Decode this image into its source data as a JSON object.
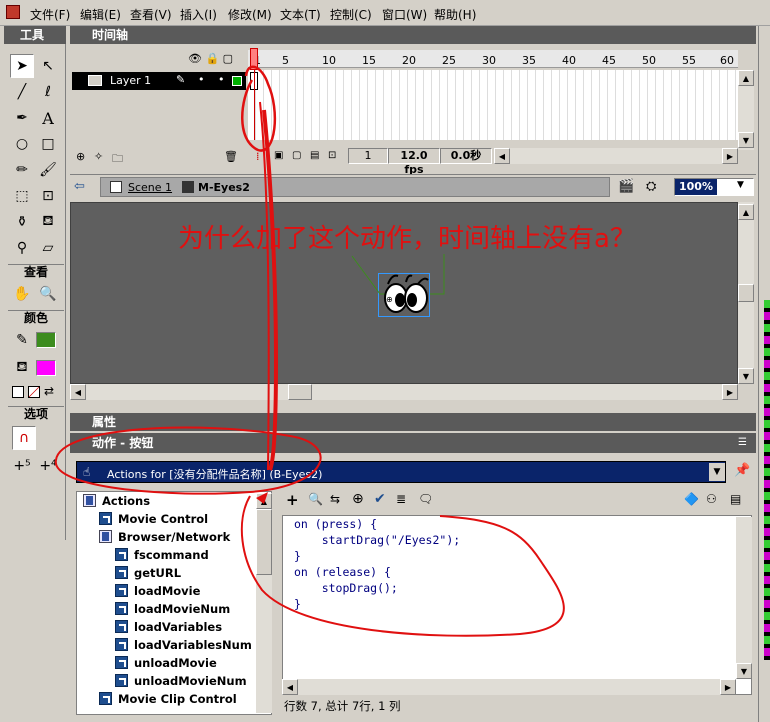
{
  "menu": {
    "items": [
      "文件(F)",
      "编辑(E)",
      "查看(V)",
      "插入(I)",
      "修改(M)",
      "文本(T)",
      "控制(C)",
      "窗口(W)",
      "帮助(H)"
    ]
  },
  "tools_panel": {
    "title": "工具",
    "view_label": "查看",
    "colors_label": "颜色",
    "options_label": "选项"
  },
  "timeline": {
    "title": "时间轴",
    "layer_name": "Layer 1",
    "frame_numbers": [
      "1",
      "5",
      "10",
      "15",
      "20",
      "25",
      "30",
      "35",
      "40",
      "45",
      "50",
      "55",
      "60"
    ],
    "current_frame": "1",
    "fps": "12.0 fps",
    "time": "0.0秒"
  },
  "breadcrumb": {
    "scene": "Scene 1",
    "symbol": "M-Eyes2",
    "zoom": "100%"
  },
  "annotation": {
    "question": "为什么加了这个动作，时间轴上没有a？"
  },
  "properties_panel": {
    "title": "属性"
  },
  "actions_panel": {
    "title": "动作 - 按钮",
    "target": "Actions for [没有分配件品名称] (B-Eyes2)",
    "tree": [
      {
        "label": "Actions",
        "icon": "book-icon",
        "bold": true
      },
      {
        "label": "Movie Control",
        "icon": "category-icon",
        "bold": true
      },
      {
        "label": "Browser/Network",
        "icon": "book-icon",
        "bold": true
      },
      {
        "label": "fscommand",
        "icon": "action-icon",
        "bold": true
      },
      {
        "label": "getURL",
        "icon": "action-icon",
        "bold": true
      },
      {
        "label": "loadMovie",
        "icon": "action-icon",
        "bold": true
      },
      {
        "label": "loadMovieNum",
        "icon": "action-icon",
        "bold": true
      },
      {
        "label": "loadVariables",
        "icon": "action-icon",
        "bold": true
      },
      {
        "label": "loadVariablesNum",
        "icon": "action-icon",
        "bold": true
      },
      {
        "label": "unloadMovie",
        "icon": "action-icon",
        "bold": true
      },
      {
        "label": "unloadMovieNum",
        "icon": "action-icon",
        "bold": true
      },
      {
        "label": "Movie Clip Control",
        "icon": "category-icon",
        "bold": true
      }
    ],
    "code_lines": [
      "on (press) {",
      "    startDrag(\"/Eyes2\");",
      "}",
      "on (release) {",
      "    stopDrag();",
      "}"
    ],
    "status": "行数 7, 总计 7行, 1 列"
  },
  "colors": {
    "stroke": "#3c8c1e",
    "fill": "#ff00ff",
    "annotation": "#e01010",
    "stage": "#5f5f5f"
  }
}
